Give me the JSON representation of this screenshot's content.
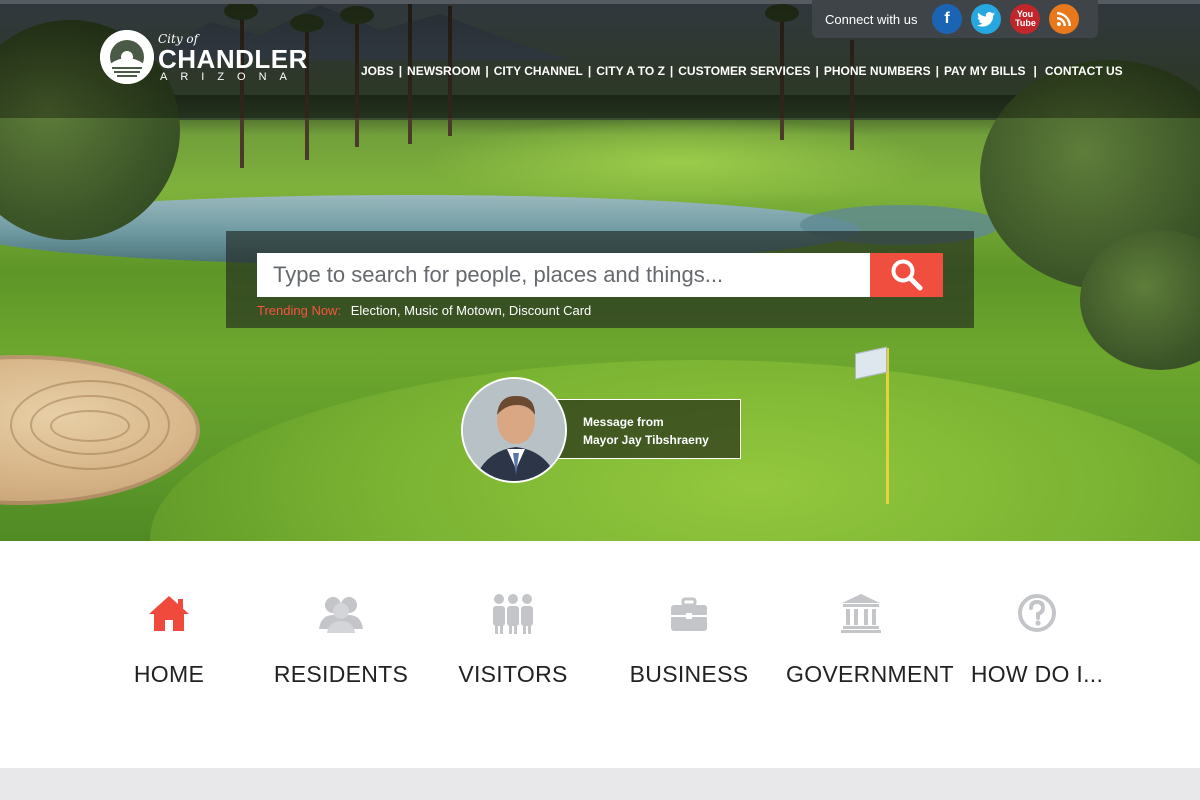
{
  "header": {
    "connect_label": "Connect with us",
    "social": [
      {
        "name": "facebook",
        "glyph": "f",
        "color": "#1b64b4"
      },
      {
        "name": "twitter",
        "glyph": "t",
        "color": "#28a6e0"
      },
      {
        "name": "youtube",
        "glyph": "You Tube",
        "color": "#c1262a"
      },
      {
        "name": "rss",
        "glyph": "rss",
        "color": "#e9781c"
      }
    ],
    "logo": {
      "city_of": "City of",
      "name": "CHANDLER",
      "state": "ARIZONA"
    },
    "nav": [
      {
        "label": "JOBS"
      },
      {
        "label": "NEWSROOM"
      },
      {
        "label": "CITY CHANNEL"
      },
      {
        "label": "CITY A TO Z"
      },
      {
        "label": "CUSTOMER SERVICES"
      },
      {
        "label": "PHONE NUMBERS"
      },
      {
        "label": "PAY MY BILLS"
      },
      {
        "label": "CONTACT US"
      }
    ],
    "nav_separator": "|"
  },
  "search": {
    "placeholder": "Type to search for people, places and things...",
    "button_icon": "search-icon",
    "button_color": "#f04e3e",
    "trending_label": "Trending Now:",
    "trending_items": "Election, Music of Motown, Discount Card"
  },
  "mayor": {
    "line1": "Message from",
    "line2": "Mayor Jay Tibshraeny"
  },
  "categories": [
    {
      "label": "HOME",
      "icon": "home-icon",
      "active": true
    },
    {
      "label": "RESIDENTS",
      "icon": "residents-icon",
      "active": false
    },
    {
      "label": "VISITORS",
      "icon": "visitors-icon",
      "active": false
    },
    {
      "label": "BUSINESS",
      "icon": "briefcase-icon",
      "active": false
    },
    {
      "label": "GOVERNMENT",
      "icon": "government-building-icon",
      "active": false
    },
    {
      "label": "HOW DO I...",
      "icon": "question-icon",
      "active": false
    }
  ],
  "colors": {
    "accent": "#f04e3e",
    "icon_inactive": "#c3c5c8",
    "icon_active": "#ef4a3c"
  }
}
